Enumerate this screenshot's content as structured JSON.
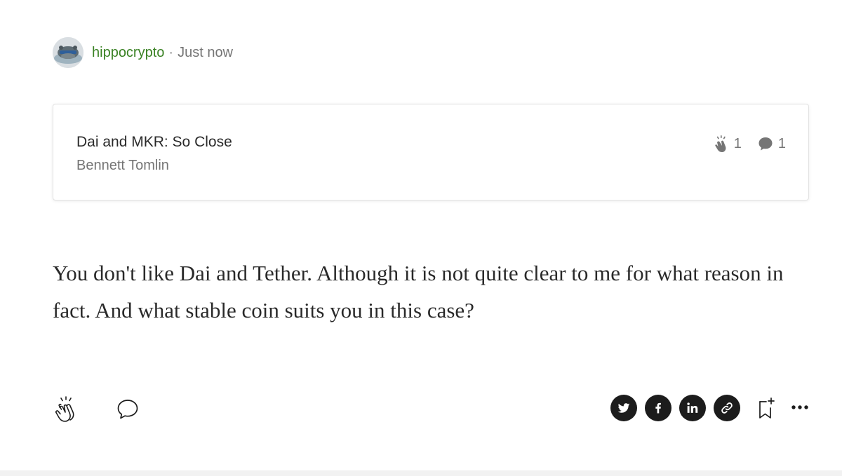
{
  "post": {
    "author": "hippocrypto",
    "separator": "·",
    "time": "Just now"
  },
  "card": {
    "title": "Dai and MKR: So Close",
    "author": "Bennett Tomlin",
    "claps": "1",
    "responses": "1"
  },
  "response": {
    "text": "You don't like Dai and Tether. Although it is not quite clear to me for what reason in fact. And what stable coin suits you in this case?"
  },
  "actions": {
    "left": [
      "clap-icon",
      "comment-icon"
    ],
    "share": [
      "twitter-icon",
      "facebook-icon",
      "linkedin-icon",
      "link-icon"
    ],
    "right": [
      "bookmark-add-icon",
      "more-icon"
    ]
  },
  "colors": {
    "author_green": "#3a8224",
    "muted_gray": "#757575",
    "share_bg": "#1c1c1c"
  }
}
